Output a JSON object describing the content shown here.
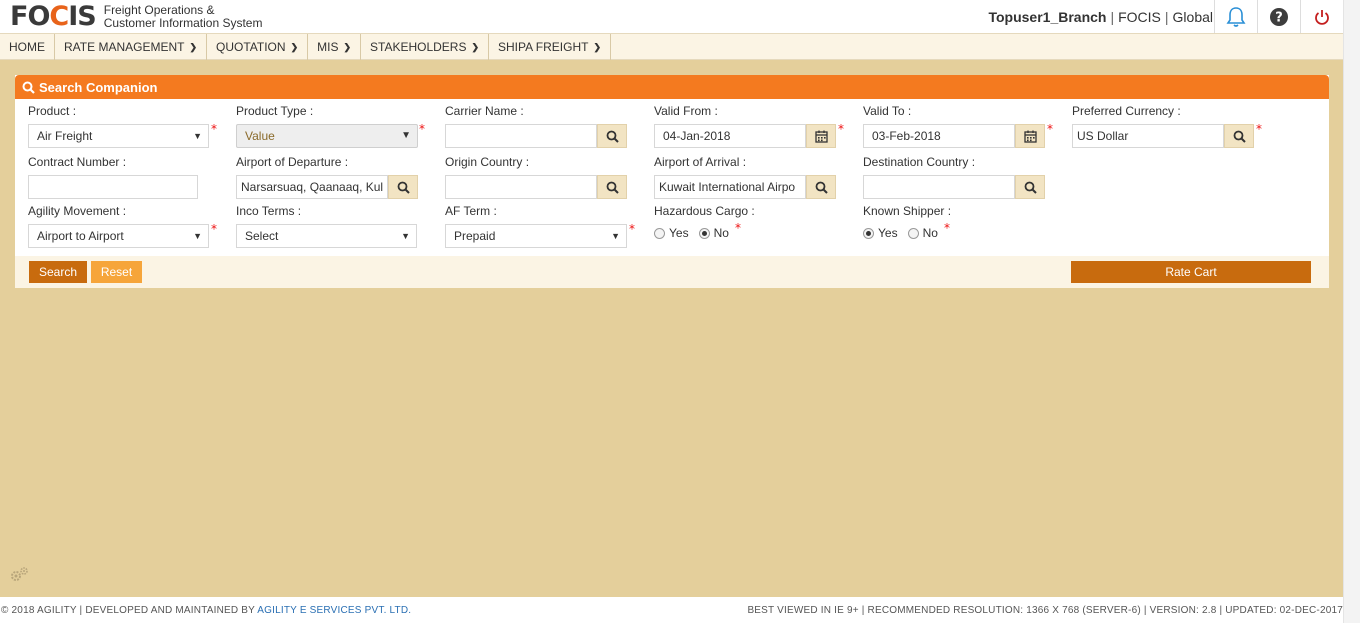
{
  "header": {
    "logo_text_a": "FO",
    "logo_text_b": "C",
    "logo_text_c": "IS",
    "logo_sub_1": "Freight Operations &",
    "logo_sub_2": "Customer Information System",
    "username": "Topuser1_Branch",
    "app": "FOCIS",
    "region": "Global"
  },
  "nav": {
    "home": "HOME",
    "rate_management": "RATE MANAGEMENT",
    "quotation": "QUOTATION",
    "mis": "MIS",
    "stakeholders": "STAKEHOLDERS",
    "shipa_freight": "SHIPA FREIGHT"
  },
  "panel": {
    "title": "Search Companion"
  },
  "form": {
    "product": {
      "label": "Product :",
      "value": "Air Freight"
    },
    "product_type": {
      "label": "Product Type :",
      "value": "Value"
    },
    "carrier_name": {
      "label": "Carrier Name :",
      "value": ""
    },
    "valid_from": {
      "label": "Valid From :",
      "value": "04-Jan-2018"
    },
    "valid_to": {
      "label": "Valid To :",
      "value": "03-Feb-2018"
    },
    "preferred_currency": {
      "label": "Preferred Currency :",
      "value": "US Dollar"
    },
    "contract_number": {
      "label": "Contract Number :",
      "value": ""
    },
    "airport_departure": {
      "label": "Airport of Departure :",
      "value": "Narsarsuaq, Qaanaaq, Kul"
    },
    "origin_country": {
      "label": "Origin Country :",
      "value": ""
    },
    "airport_arrival": {
      "label": "Airport of Arrival :",
      "value": "Kuwait International Airpo"
    },
    "destination_country": {
      "label": "Destination Country :",
      "value": ""
    },
    "agility_movement": {
      "label": "Agility Movement :",
      "value": "Airport to Airport"
    },
    "inco_terms": {
      "label": "Inco Terms :",
      "value": "Select"
    },
    "af_term": {
      "label": "AF Term :",
      "value": "Prepaid"
    },
    "hazardous_cargo": {
      "label": "Hazardous Cargo :",
      "yes": "Yes",
      "no": "No",
      "selected": "No"
    },
    "known_shipper": {
      "label": "Known Shipper :",
      "yes": "Yes",
      "no": "No",
      "selected": "Yes"
    },
    "required_mark": "*"
  },
  "actions": {
    "search": "Search",
    "reset": "Reset",
    "rate_cart": "Rate Cart"
  },
  "footer": {
    "copyright": "© 2018 AGILITY | DEVELOPED AND MAINTAINED BY ",
    "company_link": "AGILITY E SERVICES PVT. LTD.",
    "info": "BEST VIEWED IN IE 9+ | RECOMMENDED RESOLUTION: 1366 X 768 (SERVER-6) | VERSION: 2.8 | UPDATED: 02-DEC-2017"
  },
  "colors": {
    "brand_orange": "#f47a1f",
    "button_brown": "#c86b0e",
    "background_tan": "#e4cf9b"
  }
}
